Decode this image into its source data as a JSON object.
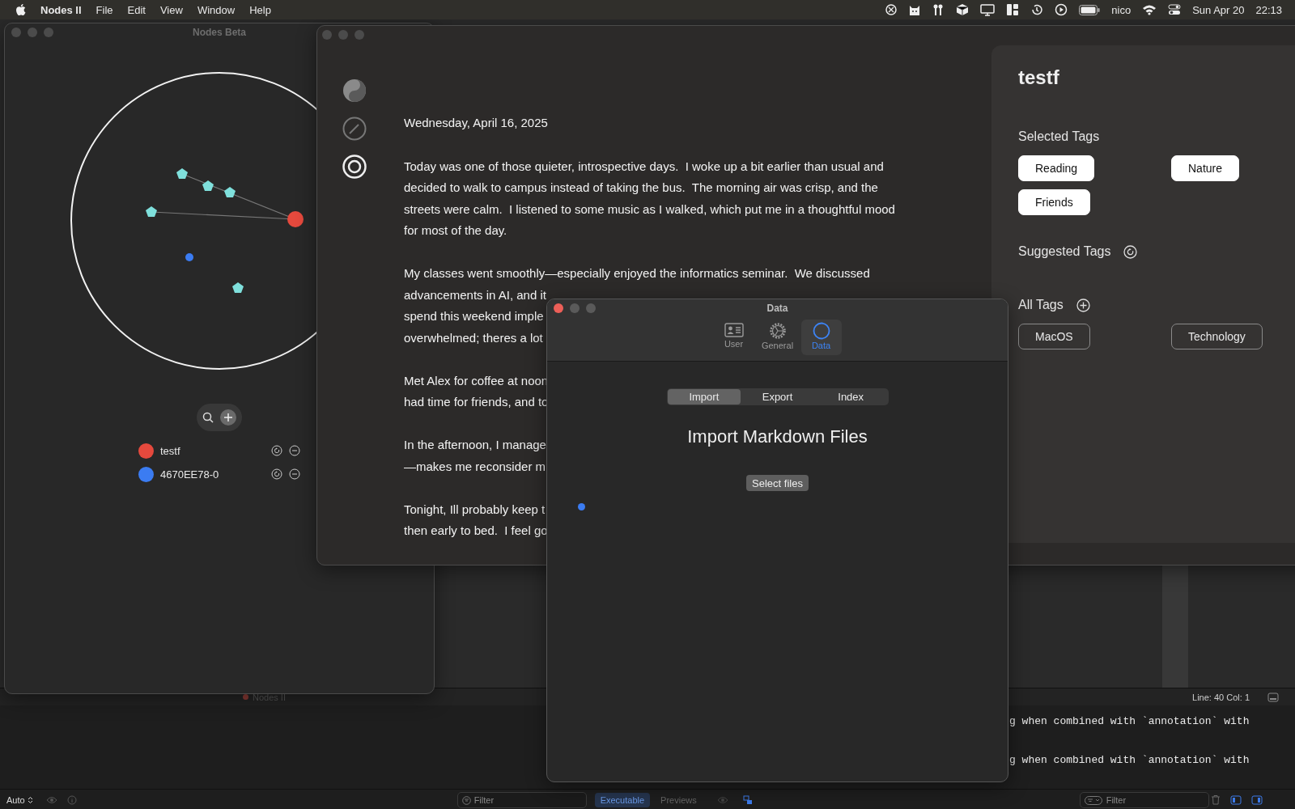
{
  "menu_bar": {
    "app_name": "Nodes II",
    "menus": [
      "File",
      "Edit",
      "View",
      "Window",
      "Help"
    ],
    "user": "nico",
    "date": "Sun Apr 20",
    "time": "22:13"
  },
  "xcode": {
    "status": "Line: 40 Col: 1",
    "scheme": "Nodes II",
    "console_lines": [
      "g when combined with `annotation` with",
      "g when combined with `annotation` with"
    ],
    "mode": "Auto",
    "filter_placeholder": "Filter",
    "tabs": [
      {
        "label": "Executable",
        "selected": true
      },
      {
        "label": "Previews",
        "selected": false
      }
    ],
    "console_filter_placeholder": "Filter"
  },
  "nodes_window": {
    "title": "Nodes Beta",
    "nodes": [
      {
        "name": "testf",
        "color": "#e5493d"
      },
      {
        "name": "4670EE78-0",
        "color": "#3b7cf2"
      }
    ]
  },
  "journal": {
    "date": "Wednesday, April 16, 2025",
    "paragraphs": [
      {
        "lines": [
          "Today was one of those quieter, introspective days.  I woke up a bit earlier than usual and",
          "decided to walk to campus instead of taking the bus.  The morning air was crisp, and the",
          "streets were calm.  I listened to some music as I walked, which put me in a thoughtful mood",
          "for most of the day."
        ]
      },
      {
        "lines": [
          "My classes went smoothly—especially enjoyed the informatics seminar.  We discussed",
          "advancements in AI, and it",
          "spend this weekend imple",
          "overwhelmed; theres a lot"
        ]
      },
      {
        "lines": [
          "Met Alex for coffee at noon",
          "had time for friends, and to"
        ]
      },
      {
        "lines": [
          "In the afternoon, I manage",
          "—makes me reconsider m"
        ]
      },
      {
        "lines": [
          "Tonight, Ill probably keep t",
          "then early to bed.  I feel go"
        ]
      }
    ]
  },
  "tag_panel": {
    "title": "testf",
    "selected_heading": "Selected Tags",
    "selected_tags": [
      {
        "label": "Reading",
        "selected": true
      },
      {
        "label": "Nature",
        "selected": true
      },
      {
        "label": "Friends",
        "selected": true
      }
    ],
    "suggested_heading": "Suggested Tags",
    "all_heading": "All Tags",
    "all_tags": [
      {
        "label": "MacOS",
        "selected": false
      },
      {
        "label": "Technology",
        "selected": false
      }
    ]
  },
  "data_dialog": {
    "title": "Data",
    "toolbar": [
      {
        "kind": "user",
        "label": "User",
        "selected": false
      },
      {
        "kind": "general",
        "label": "General",
        "selected": false
      },
      {
        "kind": "data",
        "label": "Data",
        "selected": true
      }
    ],
    "segments": [
      {
        "label": "Import",
        "selected": true
      },
      {
        "label": "Export",
        "selected": false
      },
      {
        "label": "Index",
        "selected": false
      }
    ],
    "heading": "Import Markdown Files",
    "button": "Select files"
  }
}
